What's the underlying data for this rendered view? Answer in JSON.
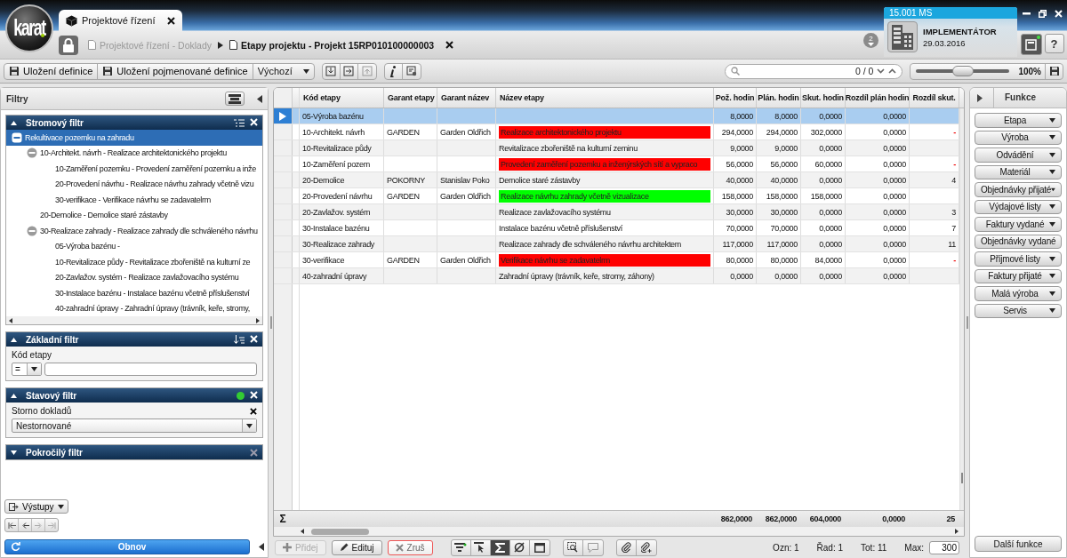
{
  "logo": "karat",
  "tabs": [
    {
      "label": "Projektové řízení",
      "selected": true
    }
  ],
  "breadcrumb": [
    {
      "label": "Projektové řízení - Doklady",
      "current": false
    },
    {
      "label": "Etapy projektu - Projekt 15RP010100000003",
      "current": true
    }
  ],
  "notifications": "2",
  "user": {
    "server": "15.001 MS",
    "role": "IMPLEMENTÁTOR",
    "date": "29.03.2016"
  },
  "help": "?",
  "toolbar": {
    "buttons": [
      "Uložení definice",
      "Uložení pojmenované definice"
    ],
    "view": "Výchozí"
  },
  "search": {
    "counter": "0 / 0"
  },
  "zoom": {
    "level": 0.5,
    "reading": "100%"
  },
  "filters": {
    "title": "Filtry",
    "panels": [
      {
        "kind": "tree",
        "title": "Stromový filtr",
        "expanded": true,
        "items": [
          {
            "label": "Rekultivace pozemku na zahradu",
            "selected": true,
            "expanded": true,
            "children": [
              {
                "label": "10-Architekt. návrh - Realizace architektonického projektu",
                "selected": false,
                "expanded": true,
                "children": [
                  {
                    "label": "10-Zaměření pozemku - Provedení zaměření pozemku a inže",
                    "selected": false
                  },
                  {
                    "label": "20-Provedení návrhu - Realizace návrhu zahrady včetně vizu",
                    "selected": false
                  },
                  {
                    "label": "30-verifikace - Verifikace návrhu se zadavatelrm",
                    "selected": false
                  }
                ]
              },
              {
                "label": "20-Demolice - Demolice staré zástavby",
                "selected": false
              },
              {
                "label": "30-Realizace zahrady - Realizace zahrady dle schváleného návrhu",
                "selected": false,
                "expanded": true,
                "children": [
                  {
                    "label": "05-Výroba bazénu -",
                    "selected": false
                  },
                  {
                    "label": "10-Revitalizace půdy - Revitalizace zbořeniště na kulturní ze",
                    "selected": false
                  },
                  {
                    "label": "20-Zavlažov. systém - Realizace zavlažovacího systému",
                    "selected": false
                  },
                  {
                    "label": "30-Instalace bazénu - Instalace bazénu včetně příslušenství",
                    "selected": false
                  },
                  {
                    "label": "40-zahradní úpravy - Zahradní úpravy (trávník, keře, stromy,",
                    "selected": false
                  }
                ]
              }
            ]
          }
        ]
      },
      {
        "kind": "basic",
        "title": "Základní filtr",
        "expanded": true,
        "field_label": "Kód etapy",
        "operator": "="
      },
      {
        "kind": "status",
        "title": "Stavový filtr",
        "expanded": true,
        "field_label": "Storno dokladů",
        "value": "Nestornované"
      },
      {
        "kind": "advanced",
        "title": "Pokročilý filtr",
        "expanded": false
      }
    ],
    "outputs": "Výstupy",
    "refresh": "Obnov"
  },
  "table": {
    "columns": [
      {
        "label": "Kód etapy",
        "kind": "text"
      },
      {
        "label": "Garant etapy",
        "kind": "text"
      },
      {
        "label": "Garant název",
        "kind": "text"
      },
      {
        "label": "Název etapy",
        "kind": "text"
      },
      {
        "label": "Pož. hodin",
        "kind": "number"
      },
      {
        "label": "Plán. hodin",
        "kind": "number"
      },
      {
        "label": "Skut. hodin",
        "kind": "number"
      },
      {
        "label": "Rozdíl plán hodin",
        "kind": "number"
      },
      {
        "label": "Rozdíl skut.",
        "kind": "number"
      }
    ],
    "rows": [
      {
        "selected": true,
        "cells": [
          "05-Výroba bazénu",
          null,
          null,
          null,
          "8,0000",
          "8,0000",
          "0,0000",
          "0,0000",
          null
        ]
      },
      {
        "selected": false,
        "negative": true,
        "color": "#ff0000",
        "cells": [
          "10-Architekt. návrh",
          "GARDEN",
          "Garden Oldřich",
          "Realizace architektonického projektu",
          "294,0000",
          "294,0000",
          "302,0000",
          "0,0000",
          "-"
        ]
      },
      {
        "selected": false,
        "cells": [
          "10-Revitalizace půdy",
          null,
          null,
          "Revitalizace zbořeniště na kulturní zeminu",
          "9,0000",
          "9,0000",
          "0,0000",
          "0,0000",
          null
        ]
      },
      {
        "selected": false,
        "negative": true,
        "color": "#ff0000",
        "cells": [
          "10-Zaměření pozem",
          null,
          null,
          "Provedení zaměření pozemku a inženýrských sítí a vypraco",
          "56,0000",
          "56,0000",
          "60,0000",
          "0,0000",
          "-"
        ]
      },
      {
        "selected": false,
        "negative": false,
        "cells": [
          "20-Demolice",
          "POKORNY",
          "Stanislav Poko",
          "Demolice staré zástavby",
          "40,0000",
          "40,0000",
          "0,0000",
          "0,0000",
          "4"
        ]
      },
      {
        "selected": false,
        "color": "#00ff00",
        "cells": [
          "20-Provedení návrhu",
          "GARDEN",
          "Garden Oldřich",
          "Realizace návrhu zahrady včetně vizualizace",
          "158,0000",
          "158,0000",
          "158,0000",
          "0,0000",
          null
        ]
      },
      {
        "selected": false,
        "negative": false,
        "cells": [
          "20-Zavlažov. systém",
          null,
          null,
          "Realizace zavlažovacího systému",
          "30,0000",
          "30,0000",
          "0,0000",
          "0,0000",
          "3"
        ]
      },
      {
        "selected": false,
        "negative": false,
        "cells": [
          "30-Instalace bazénu",
          null,
          null,
          "Instalace bazénu včetně příslušenství",
          "70,0000",
          "70,0000",
          "0,0000",
          "0,0000",
          "7"
        ]
      },
      {
        "selected": false,
        "negative": false,
        "cells": [
          "30-Realizace zahrady",
          null,
          null,
          "Realizace zahrady dle schváleného návrhu architektem",
          "117,0000",
          "117,0000",
          "0,0000",
          "0,0000",
          "11"
        ]
      },
      {
        "selected": false,
        "negative": true,
        "color": "#ff0000",
        "cells": [
          "30-verifikace",
          "GARDEN",
          "Garden Oldřich",
          "Verifikace návrhu se zadavatelrm",
          "80,0000",
          "80,0000",
          "84,0000",
          "0,0000",
          "-"
        ]
      },
      {
        "selected": false,
        "cells": [
          "40-zahradní úpravy",
          null,
          null,
          "Zahradní úpravy (trávník, keře, stromy, záhony)",
          "0,0000",
          "0,0000",
          "0,0000",
          "0,0000",
          null
        ]
      }
    ],
    "totals_symbol": "Σ",
    "totals": [
      "862,0000",
      "862,0000",
      "604,0000",
      "0,0000",
      "25"
    ]
  },
  "actions": [
    {
      "kind": "add",
      "label": "Přidej",
      "disabled": true
    },
    {
      "kind": "edit",
      "label": "Edituj",
      "disabled": false
    },
    {
      "kind": "delete",
      "label": "Zruš",
      "disabled": false
    }
  ],
  "status_bar": [
    {
      "label": "Ozn:",
      "value": "1"
    },
    {
      "label": "Řad:",
      "value": "1"
    },
    {
      "label": "Tot:",
      "value": "11"
    }
  ],
  "max": {
    "label": "Max:",
    "value": "300"
  },
  "functions": {
    "title": "Funkce",
    "buttons": [
      "Etapa",
      "Výroba",
      "Odvádění",
      "Materiál",
      "Objednávky přijaté",
      "Výdajové listy",
      "Faktury vydané",
      "Objednávky vydané",
      "Příjmové listy",
      "Faktury přijaté",
      "Malá výroba",
      "Servis"
    ],
    "more": "Další funkce"
  }
}
